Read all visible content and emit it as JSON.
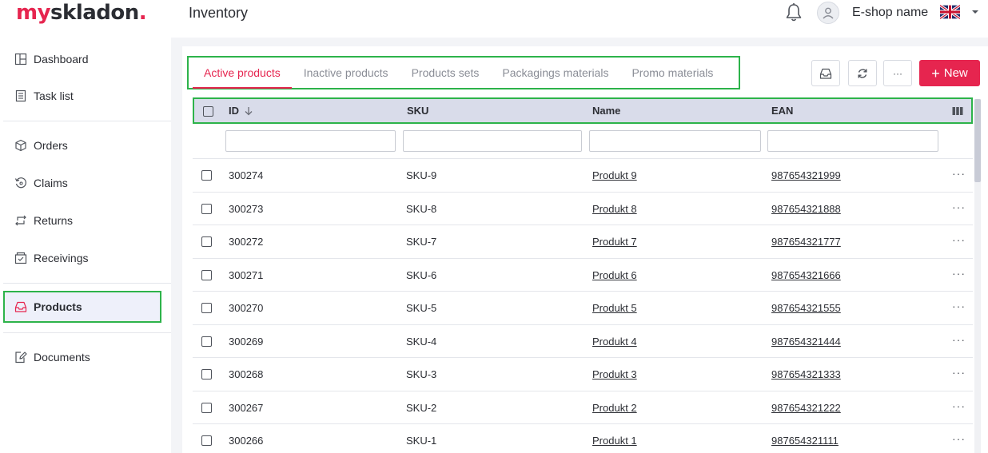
{
  "app": {
    "logo": {
      "part1": "my",
      "part2": "skladon",
      "dot": "."
    },
    "page_title": "Inventory",
    "shop_name": "E-shop name",
    "language_icon": "uk-flag-icon",
    "colors": {
      "brand": "#e6254f",
      "highlight": "#2db34a",
      "header_bg": "#d9dcea"
    }
  },
  "sidebar": {
    "items": [
      {
        "label": "Dashboard",
        "icon": "dashboard-icon"
      },
      {
        "label": "Task list",
        "icon": "task-list-icon"
      },
      {
        "label": "Orders",
        "icon": "box-icon"
      },
      {
        "label": "Claims",
        "icon": "claims-icon"
      },
      {
        "label": "Returns",
        "icon": "returns-icon"
      },
      {
        "label": "Receivings",
        "icon": "receivings-icon"
      },
      {
        "label": "Products",
        "icon": "inbox-icon",
        "active": true
      },
      {
        "label": "Documents",
        "icon": "document-edit-icon"
      }
    ]
  },
  "tabs": [
    {
      "label": "Active products",
      "active": true
    },
    {
      "label": "Inactive products"
    },
    {
      "label": "Products sets"
    },
    {
      "label": "Packagings materials"
    },
    {
      "label": "Promo materials"
    }
  ],
  "toolbar": {
    "more_label": "···",
    "new_label": "New",
    "new_plus": "+"
  },
  "table": {
    "columns": {
      "id": "ID",
      "sku": "SKU",
      "name": "Name",
      "ean": "EAN"
    },
    "row_more": "···",
    "rows": [
      {
        "id": "300274",
        "sku": "SKU-9",
        "name": "Produkt 9",
        "ean": "987654321999"
      },
      {
        "id": "300273",
        "sku": "SKU-8",
        "name": "Produkt 8",
        "ean": "987654321888"
      },
      {
        "id": "300272",
        "sku": "SKU-7",
        "name": "Produkt 7",
        "ean": "987654321777"
      },
      {
        "id": "300271",
        "sku": "SKU-6",
        "name": "Produkt 6",
        "ean": "987654321666"
      },
      {
        "id": "300270",
        "sku": "SKU-5",
        "name": "Produkt 5",
        "ean": "987654321555"
      },
      {
        "id": "300269",
        "sku": "SKU-4",
        "name": "Produkt 4",
        "ean": "987654321444"
      },
      {
        "id": "300268",
        "sku": "SKU-3",
        "name": "Produkt 3",
        "ean": "987654321333"
      },
      {
        "id": "300267",
        "sku": "SKU-2",
        "name": "Produkt 2",
        "ean": "987654321222"
      },
      {
        "id": "300266",
        "sku": "SKU-1",
        "name": "Produkt 1",
        "ean": "987654321111"
      }
    ]
  }
}
